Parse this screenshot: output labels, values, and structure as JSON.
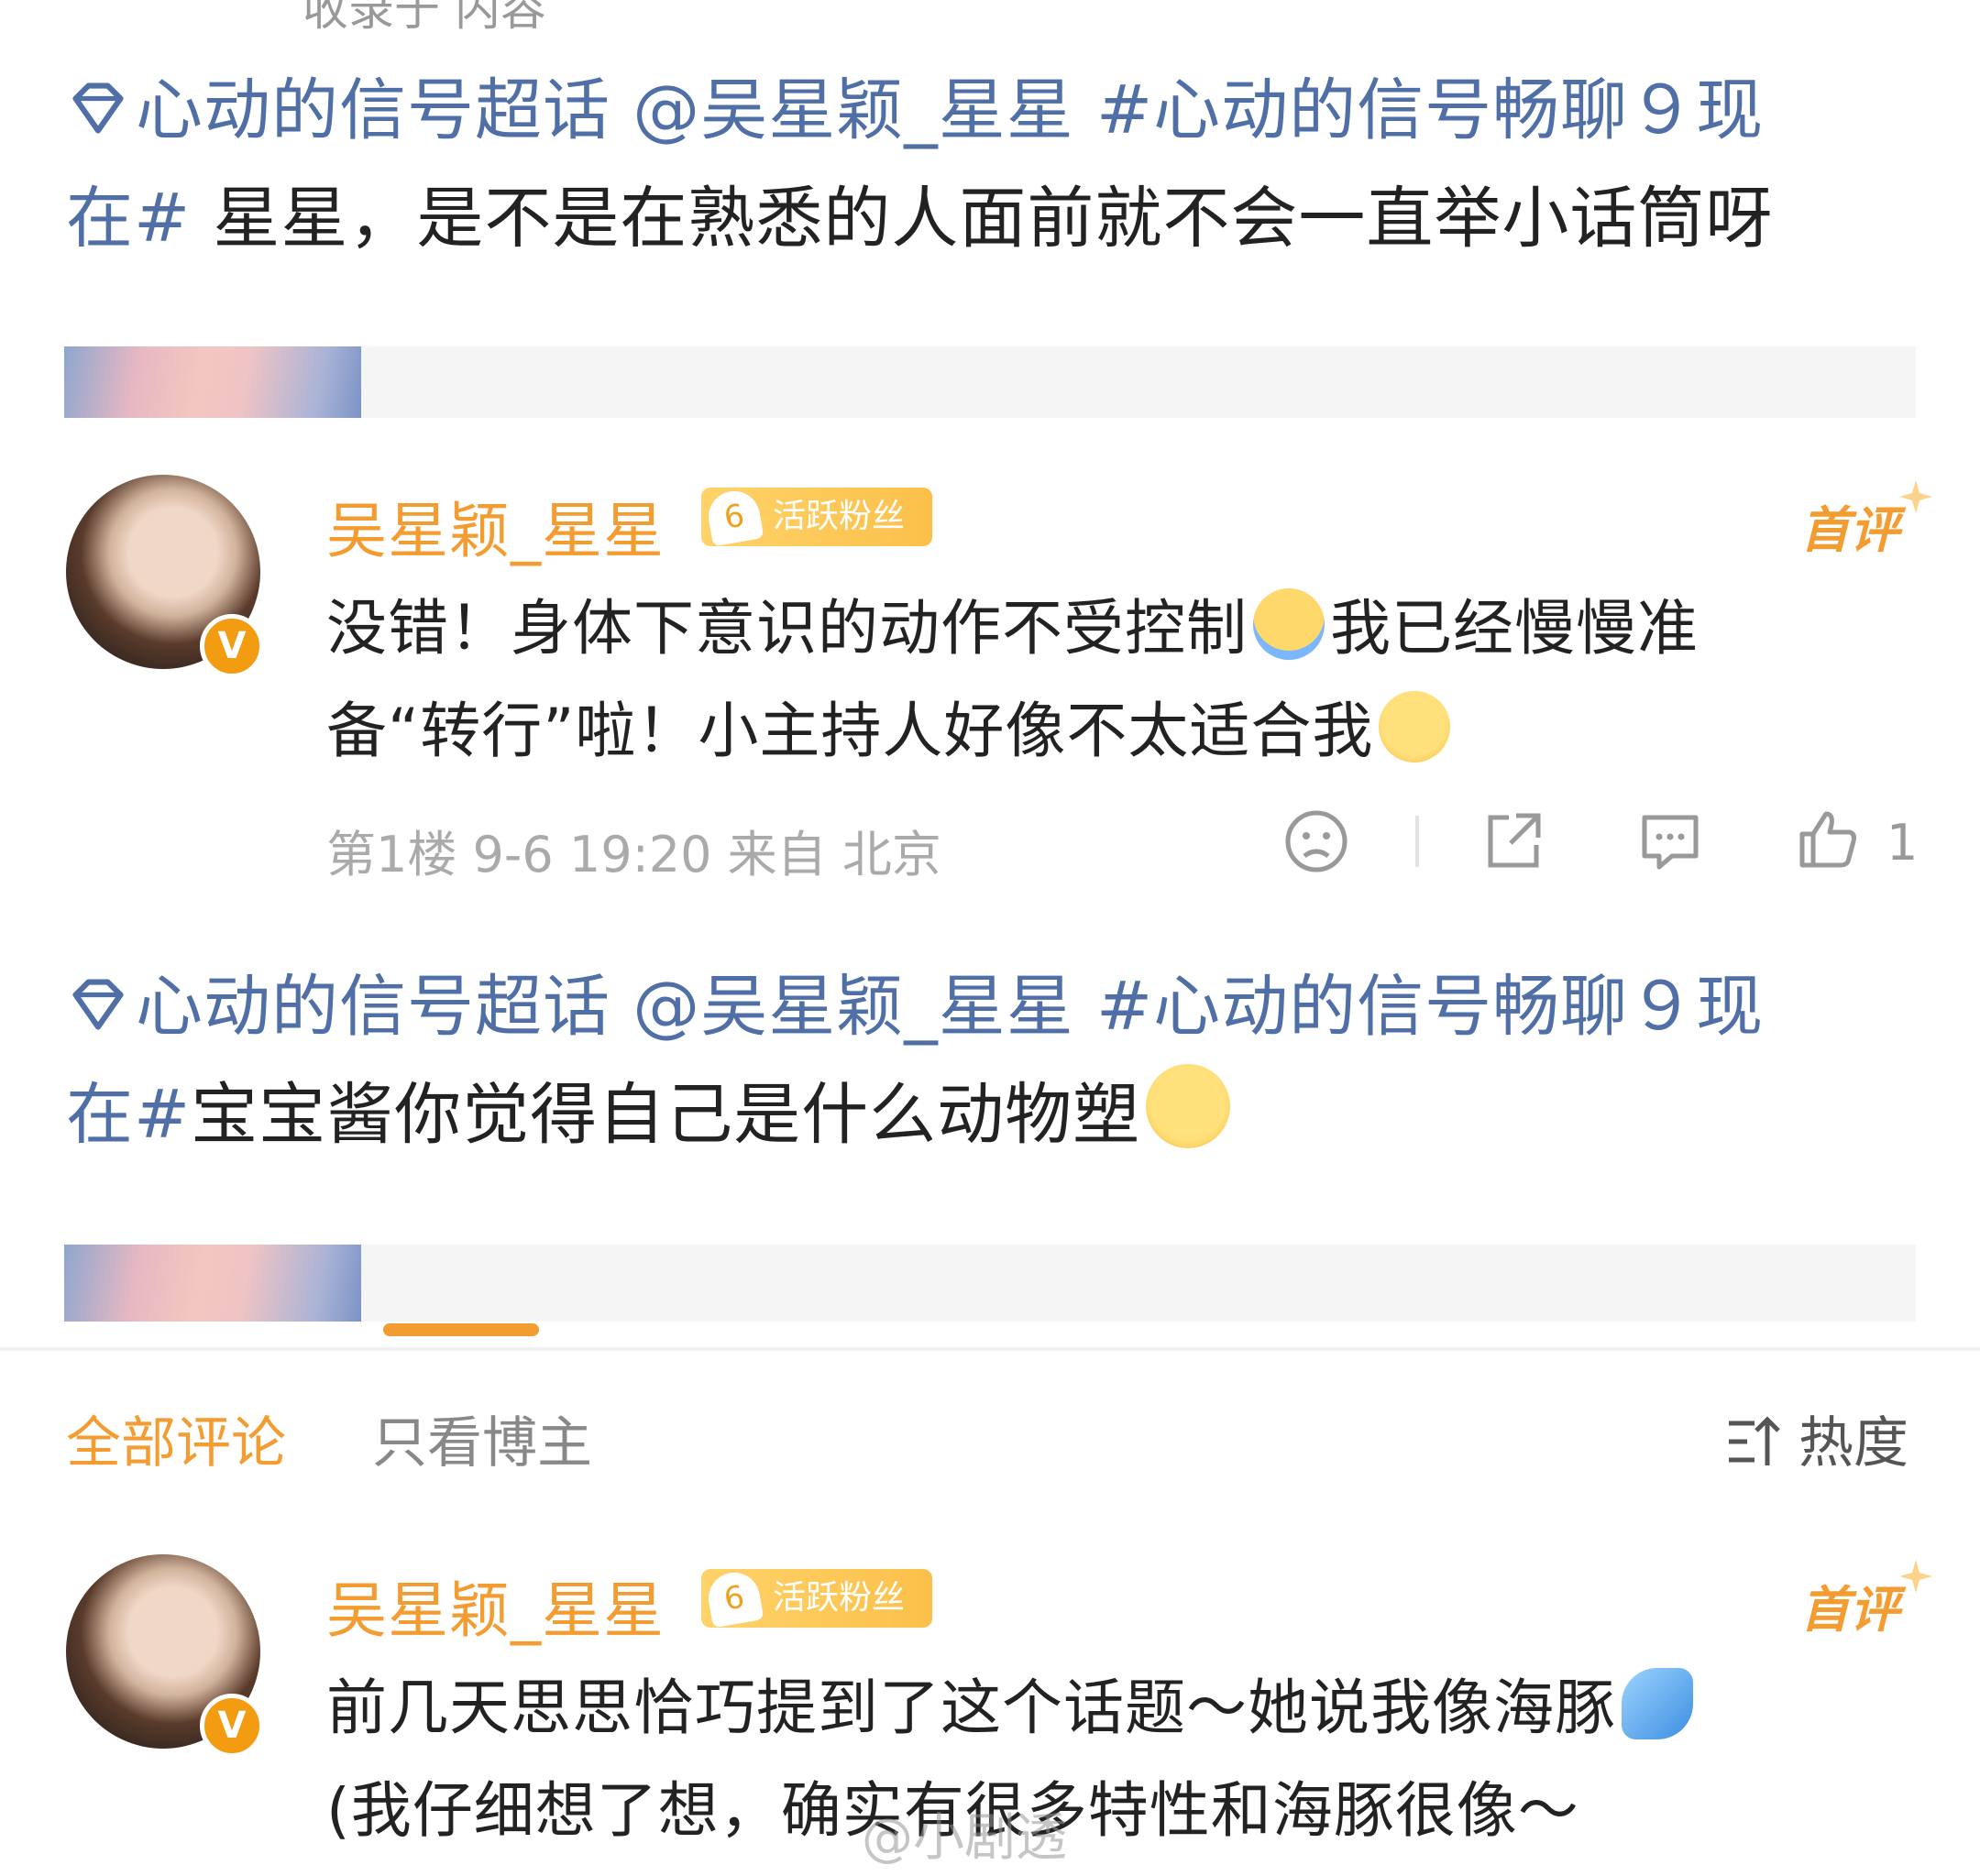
{
  "clipped_top_text": "收录于 内容",
  "posts": [
    {
      "topic": "心动的信号超话",
      "mention": "@吴星颖_星星",
      "hashtag_a": "#心动的信号畅聊９现",
      "hashtag_b": "在#",
      "text": " 星星，是不是在熟悉的人面前就不会一直举小话筒呀"
    },
    {
      "topic": "心动的信号超话",
      "mention": "@吴星颖_星星",
      "hashtag_a": "#心动的信号畅聊９现",
      "hashtag_b": "在#",
      "text": "宝宝酱你觉得自己是什么动物塑"
    }
  ],
  "reply1": {
    "username": "吴星颖_星星",
    "fan_level": "6",
    "fan_badge": "活跃粉丝",
    "first_comment": "首评",
    "line1a": "没错！身体下意识的动作不受控制",
    "line1b": "我已经慢慢准",
    "line2": "备“转行”啦！小主持人好像不太适合我",
    "meta": "第1楼 9-6 19:20 来自 北京",
    "like_count": "1"
  },
  "tabs": {
    "all": "全部评论",
    "owner_only": "只看博主",
    "sort": "热度"
  },
  "reply2": {
    "username": "吴星颖_星星",
    "fan_level": "6",
    "fan_badge": "活跃粉丝",
    "first_comment": "首评",
    "line1": "前几天思思恰巧提到了这个话题～她说我像海豚",
    "line2": "(我仔细想了想，确实有很多特性和海豚很像～"
  },
  "watermark": "@小剧透",
  "colors": {
    "accent": "#f39c32",
    "link": "#4f6fa6"
  }
}
